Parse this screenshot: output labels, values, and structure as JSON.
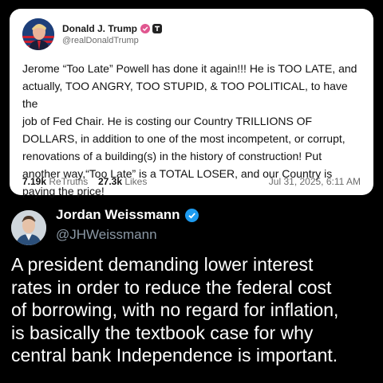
{
  "embed": {
    "author_name": "Donald J. Trump",
    "author_handle": "@realDonaldTrump",
    "body": "Jerome “Too Late” Powell has done it again!!! He is TOO LATE, and\nactually, TOO ANGRY, TOO STUPID, & TOO POLITICAL, to have the\njob of Fed Chair. He is costing our Country TRILLIONS OF\nDOLLARS, in addition to one of the most incompetent, or corrupt,\nrenovations of a building(s) in the history of construction! Put\nanother way,“Too Late” is a TOTAL LOSER, and our Country is\npaying the price!",
    "retruths_count": "7.19k",
    "retruths_label": "ReTruths",
    "likes_count": "27.3k",
    "likes_label": "Likes",
    "date": "Jul 31, 2025, 6:11 AM",
    "colors": {
      "verified": "#e0568f",
      "background": "#ffffff"
    },
    "icons": [
      "verified-badge-icon",
      "truth-social-icon"
    ]
  },
  "tweet": {
    "author_name": "Jordan Weissmann",
    "author_handle": "@JHWeissmann",
    "text": "A president demanding lower interest\nrates in order to reduce the federal cost\nof borrowing, with no regard for inflation,\nis basically the textbook case for why\ncentral bank Independence is important.",
    "colors": {
      "verified": "#1d9bf0",
      "background": "#000000",
      "handle": "#8b98a5"
    },
    "icons": [
      "verified-badge-icon"
    ]
  }
}
